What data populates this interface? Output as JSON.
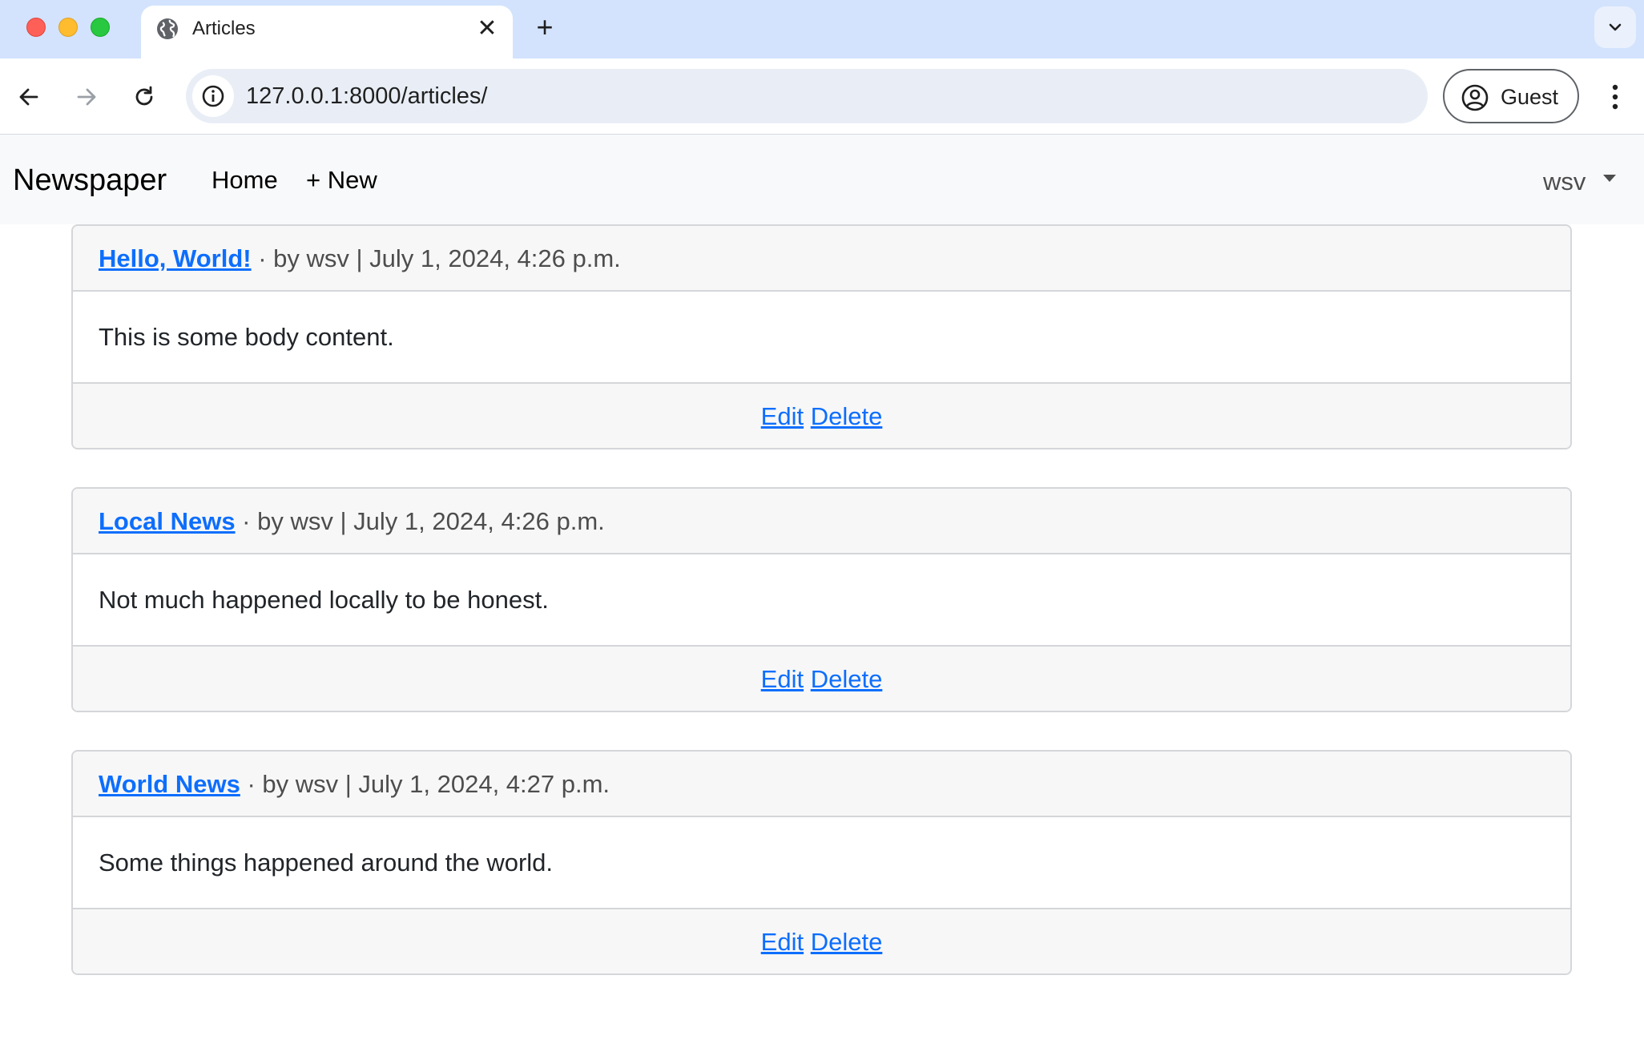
{
  "browser": {
    "tab_title": "Articles",
    "tab_close_icon": "close-icon",
    "new_tab_label": "+",
    "url": "127.0.0.1:8000/articles/",
    "profile_label": "Guest"
  },
  "navbar": {
    "brand": "Newspaper",
    "links": [
      {
        "label": "Home"
      },
      {
        "label": "+ New"
      }
    ],
    "user": "wsv"
  },
  "articles": [
    {
      "title": "Hello, World!",
      "meta": " · by wsv | July 1, 2024, 4:26 p.m.",
      "body": "This is some body content.",
      "edit_label": "Edit",
      "delete_label": "Delete"
    },
    {
      "title": "Local News",
      "meta": " · by wsv | July 1, 2024, 4:26 p.m.",
      "body": "Not much happened locally to be honest.",
      "edit_label": "Edit",
      "delete_label": "Delete"
    },
    {
      "title": "World News",
      "meta": " · by wsv | July 1, 2024, 4:27 p.m.",
      "body": "Some things happened around the world.",
      "edit_label": "Edit",
      "delete_label": "Delete"
    }
  ],
  "colors": {
    "link": "#0d6efd",
    "tabstrip": "#d3e3fd",
    "navbar_bg": "#f8f9fa"
  }
}
